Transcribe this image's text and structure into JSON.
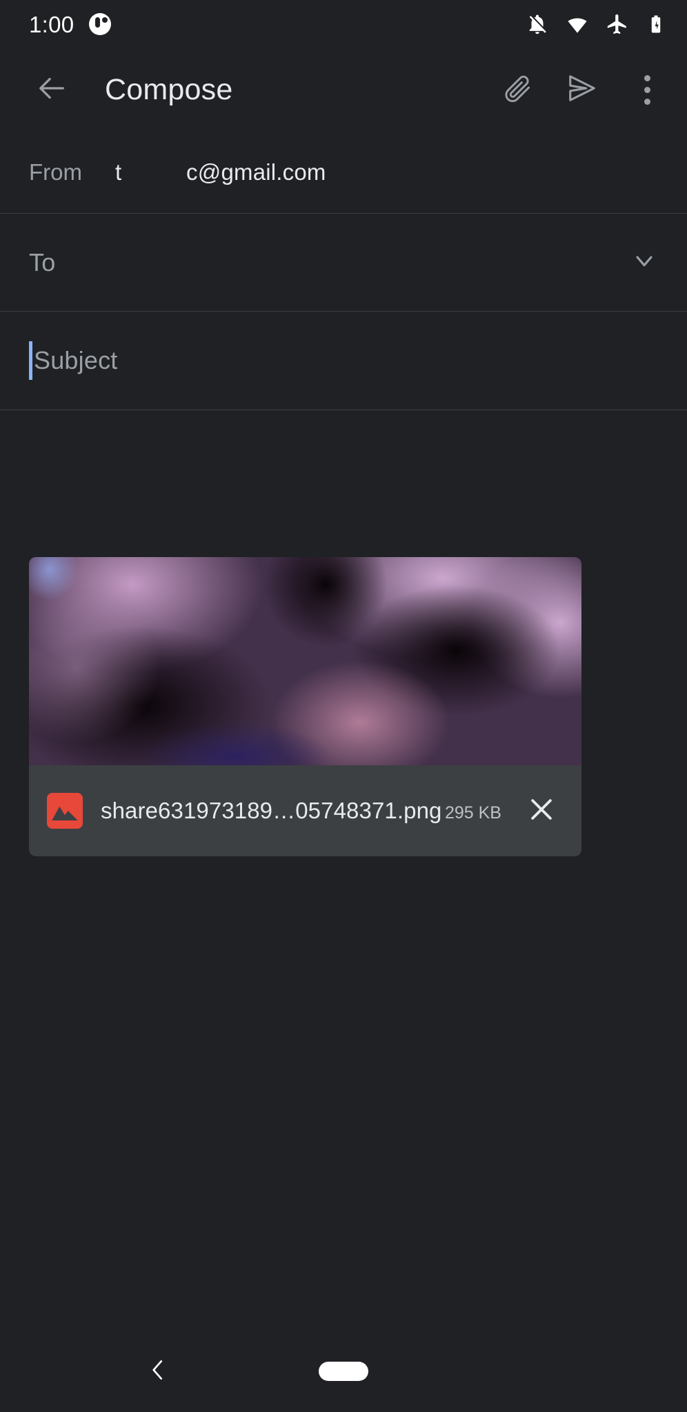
{
  "status_bar": {
    "time": "1:00",
    "icons": [
      {
        "name": "notification-badge-icon"
      },
      {
        "name": "notifications-off-icon"
      },
      {
        "name": "wifi-icon"
      },
      {
        "name": "airplane-mode-icon"
      },
      {
        "name": "battery-charging-icon"
      }
    ]
  },
  "app_bar": {
    "back_icon": "arrow-back-icon",
    "title": "Compose",
    "actions": [
      {
        "name": "attach-file-icon",
        "label": "Attach file"
      },
      {
        "name": "send-icon",
        "label": "Send"
      },
      {
        "name": "more-options-icon",
        "label": "More options"
      }
    ]
  },
  "fields": {
    "from": {
      "label": "From",
      "value": "t          c@gmail.com"
    },
    "to": {
      "placeholder": "To",
      "value": "",
      "expand_icon": "chevron-down-icon"
    },
    "subject": {
      "placeholder": "Subject",
      "value": "",
      "caret_color": "#8ab4f8"
    }
  },
  "attachment": {
    "file_name": "share631973189…05748371.png",
    "file_size": "295 KB",
    "type_icon": "image-file-icon",
    "type_icon_color": "#e8483a",
    "remove_icon": "close-icon",
    "thumbnail_alt": "blurred purple photo preview"
  },
  "nav_bar": {
    "back_icon": "nav-back-chevron-icon",
    "home_indicator": "home-pill-indicator"
  },
  "colors": {
    "background": "#202124",
    "surface": "#3c4043",
    "divider": "#3b3d40",
    "text_primary": "#e8eaed",
    "text_secondary": "#9aa0a6",
    "accent": "#8ab4f8"
  }
}
